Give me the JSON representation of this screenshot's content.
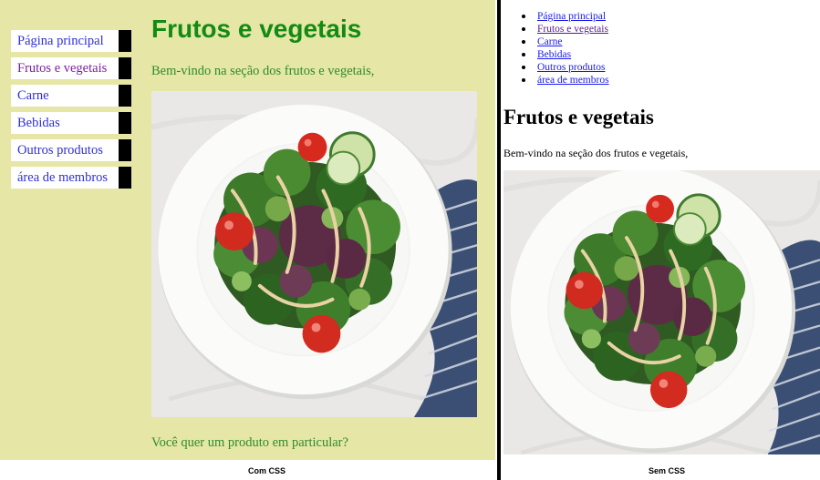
{
  "with_css": {
    "nav": {
      "items": [
        {
          "label": "Página principal"
        },
        {
          "label": "Frutos e vegetais"
        },
        {
          "label": "Carne"
        },
        {
          "label": "Bebidas"
        },
        {
          "label": "Outros produtos"
        },
        {
          "label": "área de membros"
        }
      ]
    },
    "title": "Frutos e vegetais",
    "welcome": "Bem-vindo na seção dos frutos e vegetais,",
    "question": "Você quer um produto em particular?",
    "caption": "Com CSS",
    "colors": {
      "background": "#e6e6a6",
      "title": "#138b13",
      "body_text": "#2e8b2e",
      "link": "#2f2fd6",
      "visited_link": "#7b1fa2"
    }
  },
  "without_css": {
    "nav": {
      "items": [
        {
          "label": "Página principal"
        },
        {
          "label": "Frutos e vegetais"
        },
        {
          "label": "Carne"
        },
        {
          "label": "Bebidas"
        },
        {
          "label": "Outros produtos"
        },
        {
          "label": "área de membros"
        }
      ]
    },
    "title": "Frutos e vegetais",
    "welcome": "Bem-vindo na seção dos frutos e vegetais,",
    "caption": "Sem CSS"
  },
  "image": {
    "subject": "salad-plate-photo"
  }
}
